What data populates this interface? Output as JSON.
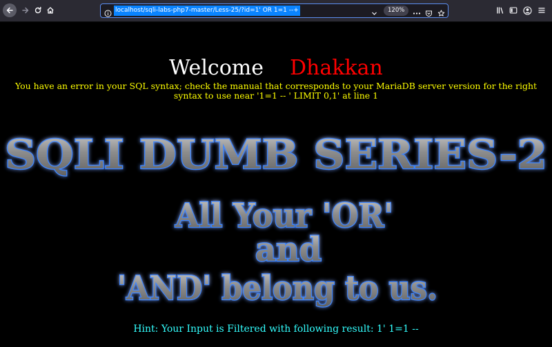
{
  "browser": {
    "url": "localhost/sqli-labs-php7-master/Less-25/?id=1' OR 1=1 --+",
    "zoom": "120%"
  },
  "page": {
    "welcome_word": "Welcome",
    "welcome_name": "Dhakkan",
    "error_message": "You have an error in your SQL syntax; check the manual that corresponds to your MariaDB server version for the right syntax to use near '1=1 -- ' LIMIT 0,1' at line 1",
    "banner_title": "SQLI DUMB SERIES-2",
    "banner_line1": "All Your 'OR'",
    "banner_line2": "and",
    "banner_line3": "'AND' belong to us.",
    "hint": "Hint: Your Input is Filtered with following result: 1' 1=1 --"
  },
  "colors": {
    "page_background": "#000000",
    "welcome_white": "#ffffff",
    "welcome_red": "#ff0000",
    "error_yellow": "#ffff00",
    "hint_cyan": "#33ffff",
    "banner_glow": "#2f6bff",
    "banner_metal": "#9a9a9a"
  }
}
